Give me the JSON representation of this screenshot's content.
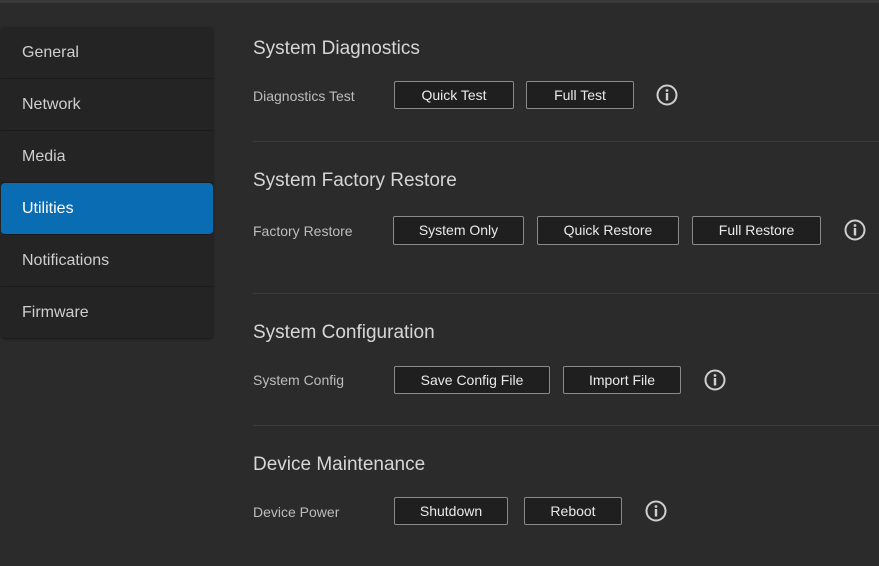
{
  "sidebar": {
    "items": [
      {
        "label": "General"
      },
      {
        "label": "Network"
      },
      {
        "label": "Media"
      },
      {
        "label": "Utilities"
      },
      {
        "label": "Notifications"
      },
      {
        "label": "Firmware"
      }
    ],
    "active": "Utilities"
  },
  "sections": {
    "diagnostics": {
      "title": "System Diagnostics",
      "label": "Diagnostics Test",
      "buttons": [
        "Quick Test",
        "Full Test"
      ],
      "icon": "info-icon"
    },
    "restore": {
      "title": "System Factory Restore",
      "label": "Factory Restore",
      "buttons": [
        "System Only",
        "Quick Restore",
        "Full Restore"
      ],
      "icon": "info-icon"
    },
    "config": {
      "title": "System Configuration",
      "label": "System Config",
      "buttons": [
        "Save Config File",
        "Import File"
      ],
      "icon": "info-icon"
    },
    "maintenance": {
      "title": "Device Maintenance",
      "label": "Device Power",
      "buttons": [
        "Shutdown",
        "Reboot"
      ],
      "icon": "info-icon"
    }
  },
  "colors": {
    "background": "#2b2b2b",
    "sidebar": "#242424",
    "accent": "#0a6db3",
    "button_border": "#8a8a8a"
  }
}
